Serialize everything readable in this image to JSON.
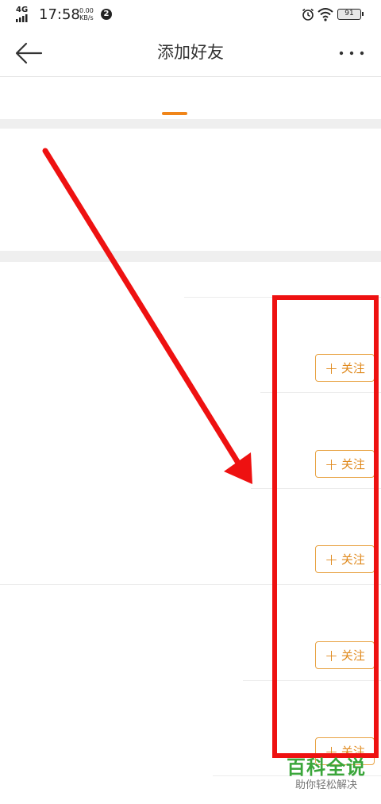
{
  "status_bar": {
    "network": "4G",
    "time": "17:58",
    "speed_value": "0.00",
    "speed_unit": "KB/s",
    "notification_count": "2",
    "battery": "91"
  },
  "header": {
    "title": "添加好友",
    "back_icon": "arrow-left-icon",
    "more_icon": "more-dots-icon"
  },
  "tab_indicator_color": "#f08519",
  "suggestions": [
    {
      "follow_label": "关注"
    },
    {
      "follow_label": "关注"
    },
    {
      "follow_label": "关注"
    },
    {
      "follow_label": "关注"
    },
    {
      "follow_label": "关注"
    }
  ],
  "annotation_color": "#ee1111",
  "watermark": {
    "title": "百科全说",
    "subtitle": "助你轻松解决"
  }
}
